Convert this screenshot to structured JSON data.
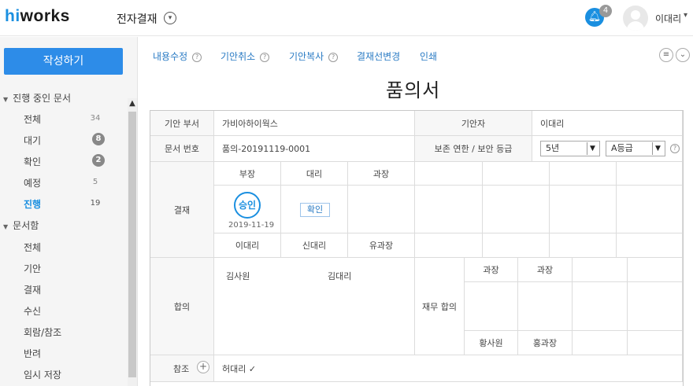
{
  "header": {
    "logo_hi": "hi",
    "logo_rest": "works",
    "app_name": "전자결재",
    "notification_count": "4",
    "user_name": "이대리"
  },
  "sidebar": {
    "compose_label": "작성하기",
    "group_in_progress": "진행 중인 문서",
    "in_progress_items": [
      {
        "label": "전체",
        "count": "34"
      },
      {
        "label": "대기",
        "count": "8"
      },
      {
        "label": "확인",
        "count": "2"
      },
      {
        "label": "예정",
        "count": "5"
      },
      {
        "label": "진행",
        "count": "19"
      }
    ],
    "group_box": "문서함",
    "box_items": [
      {
        "label": "전체"
      },
      {
        "label": "기안"
      },
      {
        "label": "결재"
      },
      {
        "label": "수신"
      },
      {
        "label": "회람/참조"
      },
      {
        "label": "반려"
      },
      {
        "label": "임시 저장"
      }
    ]
  },
  "toolbar": {
    "edit": "내용수정",
    "cancel": "기안취소",
    "copy": "기안복사",
    "change_line": "결재선변경",
    "print": "인쇄"
  },
  "document": {
    "title": "품의서",
    "dept_label": "기안 부서",
    "dept_value": "가비아하이웍스",
    "drafter_label": "기안자",
    "drafter_value": "이대리",
    "docno_label": "문서 번호",
    "docno_value": "품의-20191119-0001",
    "retention_label": "보존 연한 / 보안 등급",
    "retention_value": "5년",
    "security_value": "A등급",
    "approval_label": "결재",
    "approval_columns": [
      {
        "role": "부장",
        "status": "승인",
        "date": "2019-11-19",
        "name": "이대리"
      },
      {
        "role": "대리",
        "status": "확인",
        "date": "",
        "name": "신대리"
      },
      {
        "role": "과장",
        "status": "",
        "date": "",
        "name": "유과장"
      }
    ],
    "agreement_label": "합의",
    "agreement_names": [
      "김사원",
      "김대리"
    ],
    "finance_label": "재무 합의",
    "finance_columns": [
      {
        "role": "과장",
        "name": "황사원"
      },
      {
        "role": "과장",
        "name": "홍과장"
      }
    ],
    "reference_label": "참조",
    "reference_value": "허대리 ✓"
  },
  "colors": {
    "accent": "#1a8fe0",
    "compose_button": "#2d8ce8",
    "link": "#2a7bc4"
  },
  "icons": [
    "chevron-down-icon",
    "bell-icon",
    "user-avatar-icon",
    "help-icon",
    "list-menu-icon",
    "plus-icon"
  ]
}
